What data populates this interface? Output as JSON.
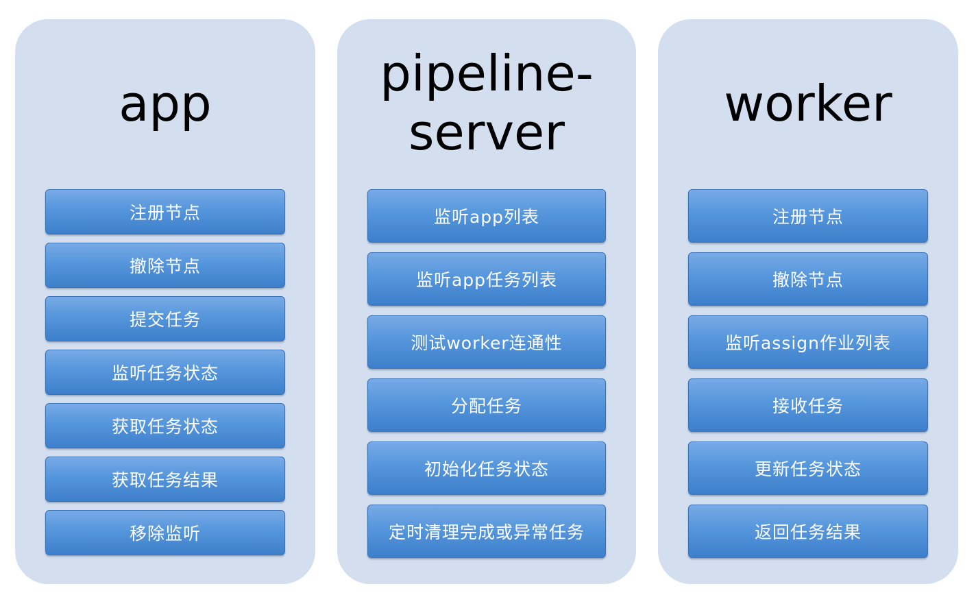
{
  "columns": [
    {
      "title": "app",
      "items": [
        "注册节点",
        "撤除节点",
        "提交任务",
        "监听任务状态",
        "获取任务状态",
        "获取任务结果",
        "移除监听"
      ]
    },
    {
      "title": "pipeline-server",
      "items": [
        "监听app列表",
        "监听app任务列表",
        "测试worker连通性",
        "分配任务",
        "初始化任务状态",
        "定时清理完成或异常任务"
      ]
    },
    {
      "title": "worker",
      "items": [
        "注册节点",
        "撤除节点",
        "监听assign作业列表",
        "接收任务",
        "更新任务状态",
        "返回任务结果"
      ]
    }
  ],
  "colors": {
    "panel_background": "#d3dfef",
    "button_top": "#78aae6",
    "button_bottom": "#3d7fca",
    "button_text": "#ffffff",
    "title_text": "#000000"
  }
}
